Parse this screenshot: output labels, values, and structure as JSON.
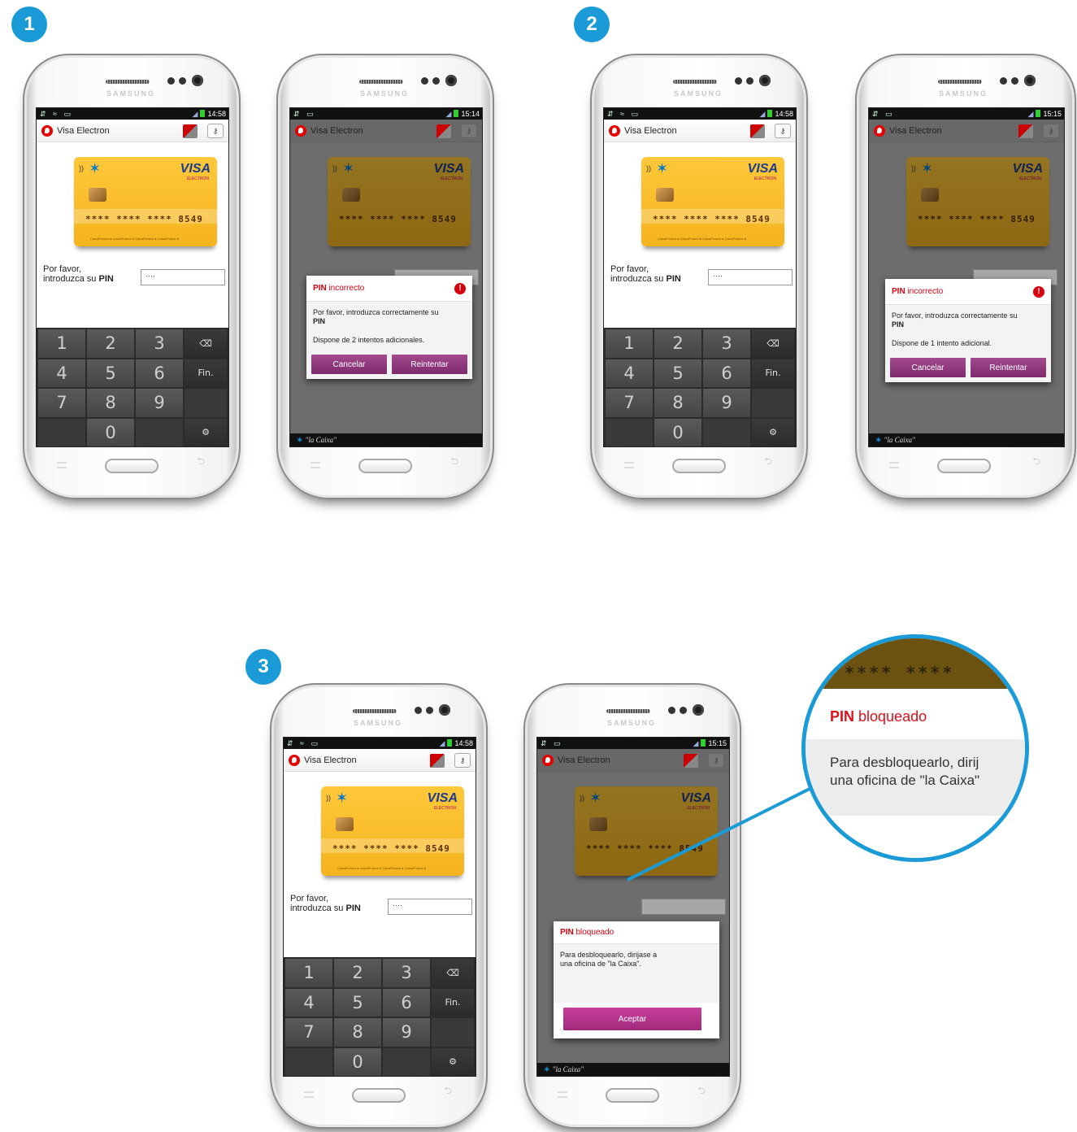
{
  "steps": [
    "1",
    "2",
    "3"
  ],
  "status": {
    "time_a": "14:58",
    "time_b": "15:14",
    "time_c": "15:15"
  },
  "app": {
    "title": "Visa Electron",
    "key_icon": "key-icon",
    "sim_icon": "sim-card-icon"
  },
  "card": {
    "brand": "VISA",
    "brand_sub": "ELECTRON",
    "number": "**** **** **** 8549",
    "bank_icon": "la-caixa-star-icon",
    "nfc_icon": "contactless-icon",
    "footer": "CaixaProtect ● CaixaProtect ● CaixaProtect ● CaixaProtect ●"
  },
  "pin": {
    "label_line1": "Por favor,",
    "label_line2_prefix": "introduzca su ",
    "label_line2_bold": "PIN",
    "value": "····"
  },
  "keypad": {
    "keys": [
      "1",
      "2",
      "3",
      "⌫",
      "4",
      "5",
      "6",
      "Fin.",
      "7",
      "8",
      "9",
      "",
      "",
      "0",
      "",
      "⚙"
    ]
  },
  "dialog_incorrect": {
    "title_bold": "PIN",
    "title_rest": " incorrecto",
    "message_line1": "Por favor, introduzca correctamente su",
    "message_line2": "PIN",
    "attempts_2": "Dispone de 2 intentos adicionales.",
    "attempts_1": "Dispone de 1 intento adicional.",
    "cancel": "Cancelar",
    "retry": "Reintentar"
  },
  "dialog_locked": {
    "title_bold": "PIN",
    "title_rest": " bloqueado",
    "message_line1": "Para desbloquearlo, dirijase a",
    "message_line2": "una oficina de \"la Caixa\".",
    "accept": "Aceptar"
  },
  "zoom": {
    "card_number": "**** ****",
    "title_bold": "PIN",
    "title_rest": " bloqueado",
    "line1": "Para desbloquearlo, dirij",
    "line2": "una oficina de \"la Caixa\""
  },
  "footer_brand": "\"la Caixa\"",
  "phone_brand": "SAMSUNG",
  "colors": {
    "accent": "#1a9ad6",
    "card": "#f4b31e",
    "button": "#8a3579",
    "error": "#d8000c"
  }
}
